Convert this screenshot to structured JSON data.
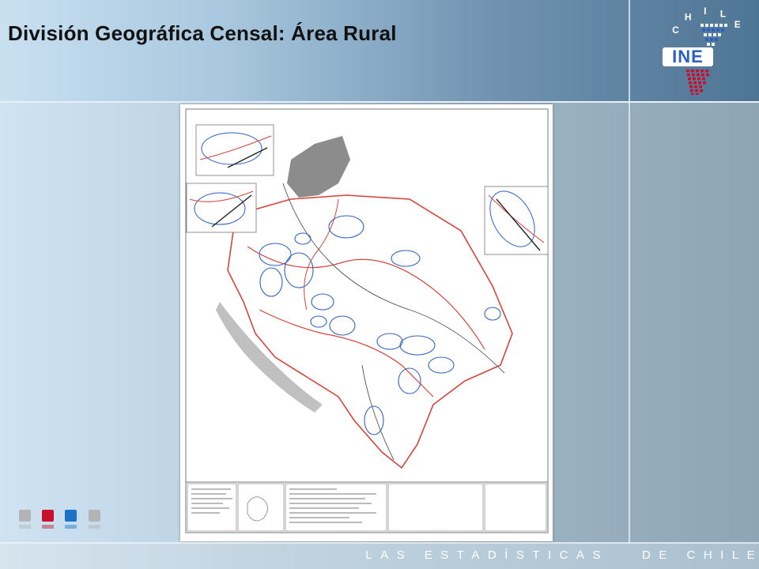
{
  "slide": {
    "title": "División Geográfica Censal: Área Rural",
    "footer_left": "LAS ESTADÍSTICAS",
    "footer_right": "DE CHILE"
  },
  "logo": {
    "arc_text": "CHILE",
    "brand_text": "INE",
    "colors": {
      "blue": "#2a5fc4",
      "red": "#c8102e",
      "white": "#ffffff"
    }
  },
  "map": {
    "icon": "census-district-map",
    "colors": {
      "boundary": "#d6453a",
      "sector": "#2f62c9",
      "urban": "#8c8c8c",
      "line": "#555555"
    }
  },
  "decor_squares": [
    {
      "name": "gray-square",
      "color": "#b3b3b3"
    },
    {
      "name": "red-square",
      "color": "#c8102e"
    },
    {
      "name": "blue-square",
      "color": "#1a73c9"
    },
    {
      "name": "light-gray-square",
      "color": "#b3b3b3"
    }
  ]
}
